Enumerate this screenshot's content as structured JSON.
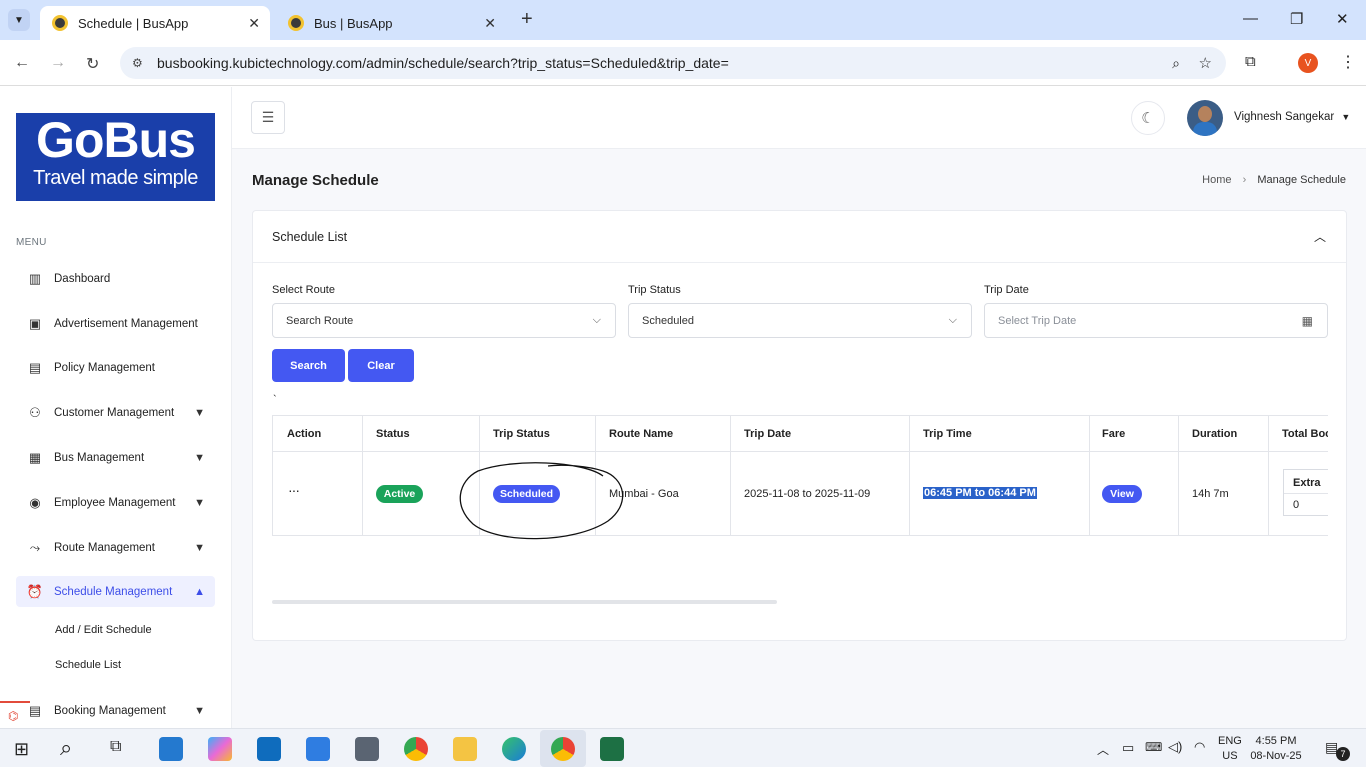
{
  "browser": {
    "tabs": [
      {
        "title": "Schedule | BusApp"
      },
      {
        "title": "Bus | BusApp"
      }
    ],
    "url": "busbooking.kubictechnology.com/admin/schedule/search?trip_status=Scheduled&trip_date=",
    "profile_initial": "V"
  },
  "logo": {
    "title": "GoBus",
    "tagline": "Travel made simple"
  },
  "sidebar": {
    "menu_title": "MENU",
    "items": [
      {
        "label": "Dashboard"
      },
      {
        "label": "Advertisement Management"
      },
      {
        "label": "Policy Management"
      },
      {
        "label": "Customer Management"
      },
      {
        "label": "Bus Management"
      },
      {
        "label": "Employee Management"
      },
      {
        "label": "Route Management"
      },
      {
        "label": "Schedule Management"
      },
      {
        "label": "Booking Management"
      }
    ],
    "subitems": [
      {
        "label": "Add / Edit Schedule"
      },
      {
        "label": "Schedule List"
      }
    ]
  },
  "header": {
    "user_name": "Vighnesh Sangekar"
  },
  "page": {
    "title": "Manage Schedule",
    "breadcrumb_home": "Home",
    "breadcrumb_current": "Manage Schedule"
  },
  "card": {
    "title": "Schedule List",
    "filters": {
      "route_label": "Select Route",
      "route_value": "Search Route",
      "status_label": "Trip Status",
      "status_value": "Scheduled",
      "date_label": "Trip Date",
      "date_placeholder": "Select Trip Date"
    },
    "search_label": "Search",
    "clear_label": "Clear",
    "stray_char": "`"
  },
  "table": {
    "headers": [
      "Action",
      "Status",
      "Trip Status",
      "Route Name",
      "Trip Date",
      "Trip Time",
      "Fare",
      "Duration",
      "Total Boo"
    ],
    "row": {
      "action": "···",
      "status": "Active",
      "trip_status": "Scheduled",
      "route_name": "Mumbai - Goa",
      "trip_date": "2025-11-08 to 2025-11-09",
      "trip_time": "06:45 PM to 06:44 PM",
      "fare": "View",
      "duration": "14h 7m",
      "extra_label": "Extra",
      "extra_value": "0"
    }
  },
  "taskbar": {
    "lang": "ENG",
    "region": "US",
    "time": "4:55 PM",
    "date": "08-Nov-25",
    "notifications": "7"
  },
  "colors": {
    "accent": "#4458f2",
    "active_badge": "#1aa35a",
    "brand": "#1a3faa"
  }
}
